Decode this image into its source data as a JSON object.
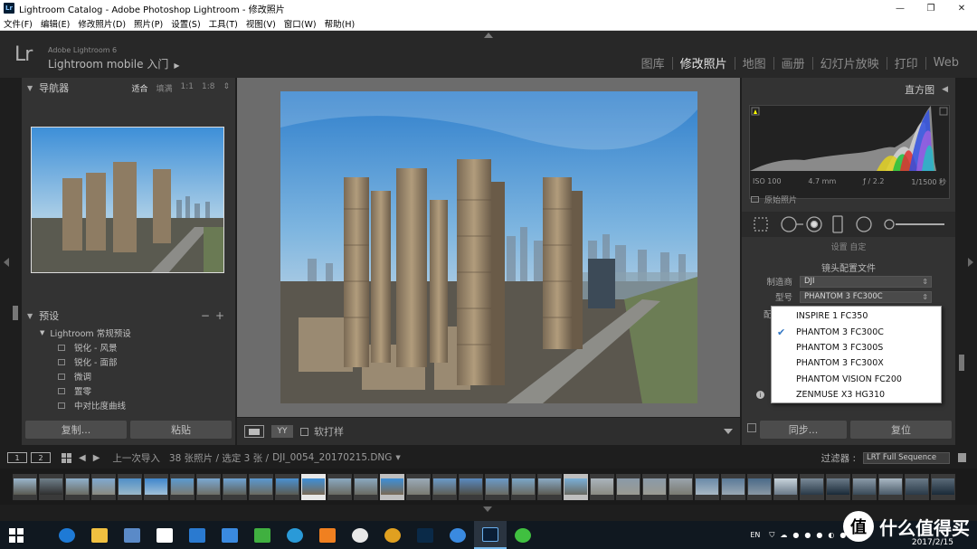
{
  "window": {
    "title": "Lightroom Catalog - Adobe Photoshop Lightroom - 修改照片",
    "controls": [
      "—",
      "❐",
      "✕"
    ]
  },
  "menu": [
    "文件(F)",
    "编辑(E)",
    "修改照片(D)",
    "照片(P)",
    "设置(S)",
    "工具(T)",
    "视图(V)",
    "窗口(W)",
    "帮助(H)"
  ],
  "identity": {
    "logo": "Lr",
    "version": "Adobe Lightroom 6",
    "mobile": "Lightroom mobile 入门"
  },
  "modules": [
    {
      "label": "图库",
      "active": false
    },
    {
      "label": "修改照片",
      "active": true
    },
    {
      "label": "地图",
      "active": false
    },
    {
      "label": "画册",
      "active": false
    },
    {
      "label": "幻灯片放映",
      "active": false
    },
    {
      "label": "打印",
      "active": false
    },
    {
      "label": "Web",
      "active": false
    }
  ],
  "navigator": {
    "title": "导航器",
    "options": [
      "适合",
      "填满",
      "1:1",
      "1:8"
    ]
  },
  "presets": {
    "title": "预设",
    "folder": "Lightroom 常规预设",
    "items": [
      "锐化 - 风景",
      "锐化 - 面部",
      "微调",
      "置零",
      "中对比度曲线"
    ]
  },
  "left_buttons": {
    "copy": "复制...",
    "paste": "粘贴"
  },
  "toolbar": {
    "yy": "YY",
    "soft_proof": "软打样"
  },
  "histogram": {
    "title": "直方图",
    "iso": "ISO 100",
    "focal": "4.7 mm",
    "aperture": "ƒ / 2.2",
    "shutter": "1/1500 秒",
    "original": "原始照片"
  },
  "lens": {
    "partial": "设置  自定",
    "title": "镜头配置文件",
    "maker_label": "制造商",
    "maker_value": "DJI",
    "model_label": "型号",
    "model_value": "PHANTOM 3 FC300C",
    "profile_label": "配"
  },
  "lens_menu": {
    "items": [
      "INSPIRE 1 FC350",
      "PHANTOM 3 FC300C",
      "PHANTOM 3 FC300S",
      "PHANTOM 3 FC300X",
      "PHANTOM VISION FC200",
      "ZENMUSE X3 HG310"
    ],
    "checked_index": 1
  },
  "right_buttons": {
    "sync": "同步...",
    "reset": "复位"
  },
  "filmstrip_nav": {
    "screen1": "1",
    "screen2": "2",
    "source": "上一次导入",
    "count": "38 张照片 / 选定 3 张 /",
    "file": "DJI_0054_20170215.DNG",
    "filter_label": "过滤器 :",
    "filter_value": "LRT Full Sequence"
  },
  "taskbar": {
    "lang": "EN",
    "date": "2017/2/15"
  },
  "watermark": {
    "badge": "值",
    "text": "什么值得买"
  }
}
